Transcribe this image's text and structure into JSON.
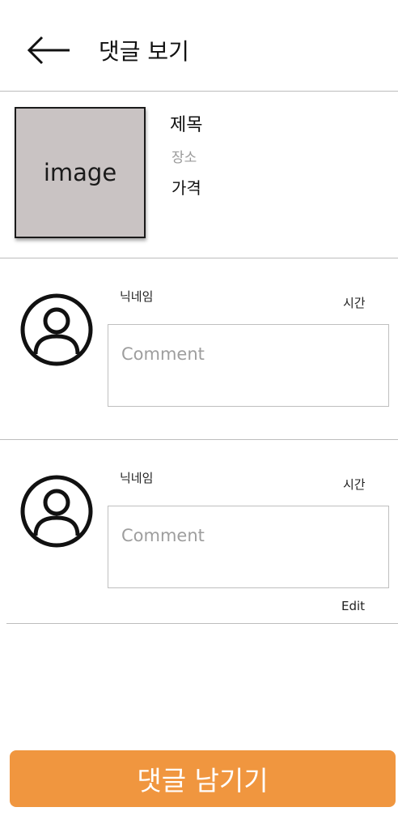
{
  "header": {
    "back_icon": "arrow-left-icon",
    "title": "댓글 보기"
  },
  "post": {
    "thumbnail_label": "image",
    "title": "제목",
    "place": "장소",
    "price": "가격"
  },
  "comments": [
    {
      "avatar_icon": "user-circle-icon",
      "nickname": "닉네임",
      "time": "시간",
      "placeholder": "Comment",
      "value": "",
      "action_label": ""
    },
    {
      "avatar_icon": "user-circle-icon",
      "nickname": "닉네임",
      "time": "시간",
      "placeholder": "Comment",
      "value": "",
      "action_label": "Edit"
    }
  ],
  "footer": {
    "leave_comment_label": "댓글 남기기"
  },
  "colors": {
    "accent": "#f0963f",
    "thumbnail_bg": "#c9c3c3",
    "muted_text": "#9a9a9a",
    "divider": "#bdbdbd"
  }
}
